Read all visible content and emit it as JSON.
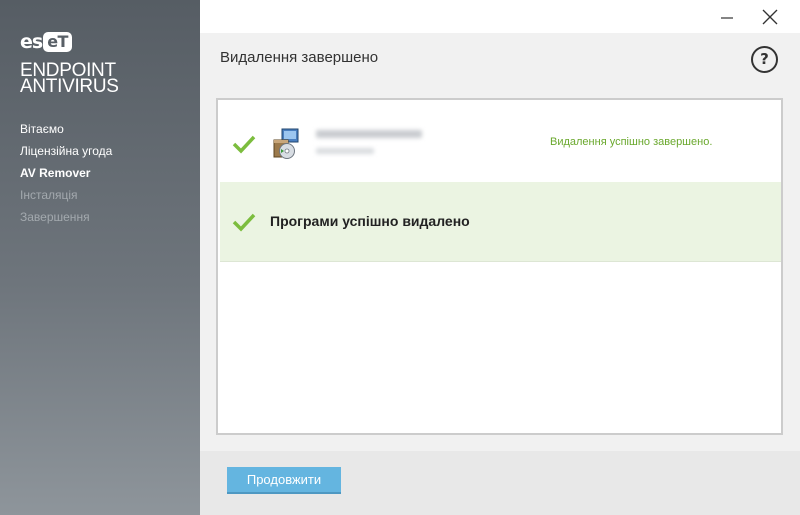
{
  "sidebar": {
    "logo_text": "es",
    "logo_badge": "eT",
    "product_line1": "ENDPOINT",
    "product_line2": "ANTIVIRUS",
    "nav": [
      {
        "label": "Вітаємо",
        "state": "normal"
      },
      {
        "label": "Ліцензійна угода",
        "state": "normal"
      },
      {
        "label": "AV Remover",
        "state": "active"
      },
      {
        "label": "Інсталяція",
        "state": "disabled"
      },
      {
        "label": "Завершення",
        "state": "disabled"
      }
    ]
  },
  "window_controls": {
    "minimize_icon": "minimize-icon",
    "close_icon": "close-icon"
  },
  "header": {
    "title": "Видалення завершено",
    "help_label": "?"
  },
  "results": {
    "app_row": {
      "status": "Видалення успішно завершено.",
      "icon": "installer-package-icon"
    },
    "summary_row": {
      "text": "Програми успішно видалено",
      "icon": "checkmark-icon"
    }
  },
  "footer": {
    "continue_label": "Продовжити"
  },
  "colors": {
    "success_green": "#6aa82d",
    "check_green": "#7cbd3e",
    "success_bg": "#ebf4e2",
    "button_blue": "#64b5e0",
    "sidebar_dark": "#565d64"
  }
}
